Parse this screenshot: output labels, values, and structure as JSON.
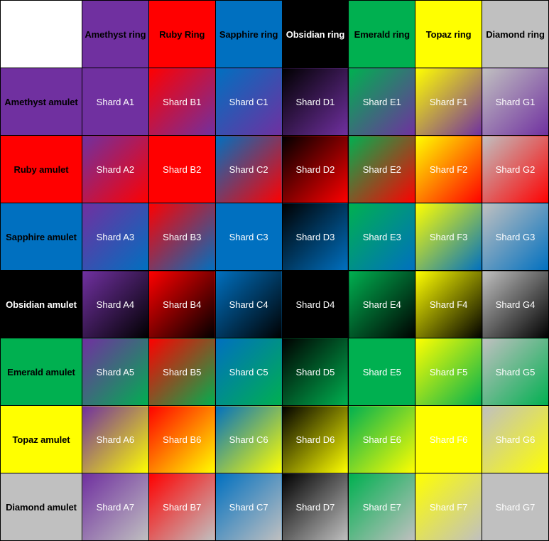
{
  "grid": {
    "corner_label": "",
    "columns": [
      {
        "key": "A",
        "label": "Amethyst ring",
        "gem": "Amethyst",
        "color": "#7030A0",
        "text_color": "#000000"
      },
      {
        "key": "B",
        "label": "Ruby Ring",
        "gem": "Ruby",
        "color": "#FF0000",
        "text_color": "#000000"
      },
      {
        "key": "C",
        "label": "Sapphire ring",
        "gem": "Sapphire",
        "color": "#0070C0",
        "text_color": "#000000"
      },
      {
        "key": "D",
        "label": "Obsidian ring",
        "gem": "Obsidian",
        "color": "#000000",
        "text_color": "#FFFFFF"
      },
      {
        "key": "E",
        "label": "Emerald ring",
        "gem": "Emerald",
        "color": "#00B050",
        "text_color": "#000000"
      },
      {
        "key": "F",
        "label": "Topaz ring",
        "gem": "Topaz",
        "color": "#FFFF00",
        "text_color": "#000000"
      },
      {
        "key": "G",
        "label": "Diamond ring",
        "gem": "Diamond",
        "color": "#C0C0C0",
        "text_color": "#000000"
      }
    ],
    "rows": [
      {
        "key": "1",
        "label": "Amethyst amulet",
        "gem": "Amethyst",
        "color": "#7030A0",
        "text_color": "#000000"
      },
      {
        "key": "2",
        "label": "Ruby amulet",
        "gem": "Ruby",
        "color": "#FF0000",
        "text_color": "#000000"
      },
      {
        "key": "3",
        "label": "Sapphire amulet",
        "gem": "Sapphire",
        "color": "#0070C0",
        "text_color": "#000000"
      },
      {
        "key": "4",
        "label": "Obsidian amulet",
        "gem": "Obsidian",
        "color": "#000000",
        "text_color": "#FFFFFF"
      },
      {
        "key": "5",
        "label": "Emerald amulet",
        "gem": "Emerald",
        "color": "#00B050",
        "text_color": "#000000"
      },
      {
        "key": "6",
        "label": "Topaz amulet",
        "gem": "Topaz",
        "color": "#FFFF00",
        "text_color": "#000000"
      },
      {
        "key": "7",
        "label": "Diamond amulet",
        "gem": "Diamond",
        "color": "#C0C0C0",
        "text_color": "#000000"
      }
    ],
    "cells": [
      [
        {
          "label": "Shard A1",
          "from": "#7030A0",
          "to": "#7030A0"
        },
        {
          "label": "Shard B1",
          "from": "#FF0000",
          "to": "#7030A0"
        },
        {
          "label": "Shard C1",
          "from": "#0070C0",
          "to": "#7030A0"
        },
        {
          "label": "Shard D1",
          "from": "#000000",
          "to": "#7030A0"
        },
        {
          "label": "Shard E1",
          "from": "#00B050",
          "to": "#7030A0"
        },
        {
          "label": "Shard F1",
          "from": "#FFFF00",
          "to": "#7030A0"
        },
        {
          "label": "Shard G1",
          "from": "#C0C0C0",
          "to": "#7030A0"
        }
      ],
      [
        {
          "label": "Shard A2",
          "from": "#7030A0",
          "to": "#FF0000"
        },
        {
          "label": "Shard B2",
          "from": "#FF0000",
          "to": "#FF0000"
        },
        {
          "label": "Shard C2",
          "from": "#0070C0",
          "to": "#FF0000"
        },
        {
          "label": "Shard D2",
          "from": "#000000",
          "to": "#FF0000"
        },
        {
          "label": "Shard E2",
          "from": "#00B050",
          "to": "#FF0000"
        },
        {
          "label": "Shard F2",
          "from": "#FFFF00",
          "to": "#FF0000"
        },
        {
          "label": "Shard G2",
          "from": "#C0C0C0",
          "to": "#FF0000"
        }
      ],
      [
        {
          "label": "Shard A3",
          "from": "#7030A0",
          "to": "#0070C0"
        },
        {
          "label": "Shard B3",
          "from": "#FF0000",
          "to": "#0070C0"
        },
        {
          "label": "Shard C3",
          "from": "#0070C0",
          "to": "#0070C0"
        },
        {
          "label": "Shard D3",
          "from": "#000000",
          "to": "#0070C0"
        },
        {
          "label": "Shard E3",
          "from": "#00B050",
          "to": "#0070C0"
        },
        {
          "label": "Shard F3",
          "from": "#FFFF00",
          "to": "#0070C0"
        },
        {
          "label": "Shard G3",
          "from": "#C0C0C0",
          "to": "#0070C0"
        }
      ],
      [
        {
          "label": "Shard A4",
          "from": "#7030A0",
          "to": "#000000"
        },
        {
          "label": "Shard B4",
          "from": "#FF0000",
          "to": "#000000"
        },
        {
          "label": "Shard C4",
          "from": "#0070C0",
          "to": "#000000"
        },
        {
          "label": "Shard D4",
          "from": "#000000",
          "to": "#000000"
        },
        {
          "label": "Shard E4",
          "from": "#00B050",
          "to": "#000000"
        },
        {
          "label": "Shard F4",
          "from": "#FFFF00",
          "to": "#000000"
        },
        {
          "label": "Shard G4",
          "from": "#C0C0C0",
          "to": "#000000"
        }
      ],
      [
        {
          "label": "Shard A5",
          "from": "#7030A0",
          "to": "#00B050"
        },
        {
          "label": "Shard B5",
          "from": "#FF0000",
          "to": "#00B050"
        },
        {
          "label": "Shard C5",
          "from": "#0070C0",
          "to": "#00B050"
        },
        {
          "label": "Shard D5",
          "from": "#000000",
          "to": "#00B050"
        },
        {
          "label": "Shard E5",
          "from": "#00B050",
          "to": "#00B050"
        },
        {
          "label": "Shard F5",
          "from": "#FFFF00",
          "to": "#00B050"
        },
        {
          "label": "Shard G5",
          "from": "#C0C0C0",
          "to": "#00B050"
        }
      ],
      [
        {
          "label": "Shard A6",
          "from": "#7030A0",
          "to": "#FFFF00"
        },
        {
          "label": "Shard B6",
          "from": "#FF0000",
          "to": "#FFFF00"
        },
        {
          "label": "Shard C6",
          "from": "#0070C0",
          "to": "#FFFF00"
        },
        {
          "label": "Shard D6",
          "from": "#000000",
          "to": "#FFFF00"
        },
        {
          "label": "Shard E6",
          "from": "#00B050",
          "to": "#FFFF00"
        },
        {
          "label": "Shard F6",
          "from": "#FFFF00",
          "to": "#FFFF00"
        },
        {
          "label": "Shard G6",
          "from": "#C0C0C0",
          "to": "#FFFF00"
        }
      ],
      [
        {
          "label": "Shard A7",
          "from": "#7030A0",
          "to": "#C0C0C0"
        },
        {
          "label": "Shard B7",
          "from": "#FF0000",
          "to": "#C0C0C0"
        },
        {
          "label": "Shard C7",
          "from": "#0070C0",
          "to": "#C0C0C0"
        },
        {
          "label": "Shard D7",
          "from": "#000000",
          "to": "#C0C0C0"
        },
        {
          "label": "Shard E7",
          "from": "#00B050",
          "to": "#C0C0C0"
        },
        {
          "label": "Shard F7",
          "from": "#FFFF00",
          "to": "#C0C0C0"
        },
        {
          "label": "Shard G7",
          "from": "#C0C0C0",
          "to": "#C0C0C0"
        }
      ]
    ],
    "cell_text_color": "#FFFFFF",
    "grid_line_color": "#000000",
    "background_color": "#FFFFFF"
  }
}
